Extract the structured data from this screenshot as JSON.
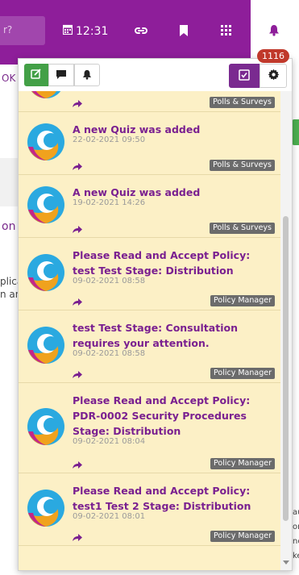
{
  "topbar": {
    "search_fragment": "r?",
    "time": "12:31",
    "background_color": "#8e1e9a"
  },
  "background_page": {
    "ok_label": "OK",
    "on_fragment": "on",
    "plica_fragment": "plica",
    "an_fragment": "n an",
    "right_fragments": [
      "au",
      "ori",
      "nov",
      "ke"
    ]
  },
  "toolbar": {
    "count": "1116",
    "icons": [
      "compose-icon",
      "comment-icon",
      "bell-icon",
      "checkbox-icon",
      "gear-icon"
    ]
  },
  "notifications": [
    {
      "title": "",
      "date": "",
      "tag": "Polls & Surveys"
    },
    {
      "title": "A new Quiz was added",
      "date": "22-02-2021 09:50",
      "tag": "Polls & Surveys"
    },
    {
      "title": "A new Quiz was added",
      "date": "19-02-2021 14:26",
      "tag": "Polls & Surveys"
    },
    {
      "title": "Please Read and Accept Policy: test Test Stage: Distribution",
      "date": "09-02-2021 08:58",
      "tag": "Policy Manager"
    },
    {
      "title": "test Test Stage: Consultation requires your attention.",
      "date": "09-02-2021 08:58",
      "tag": "Policy Manager"
    },
    {
      "title": "Please Read and Accept Policy: PDR-0002 Security Procedures Stage: Distribution",
      "date": "09-02-2021 08:04",
      "tag": "Policy Manager"
    },
    {
      "title": "Please Read and Accept Policy: test1 Test 2 Stage: Distribution",
      "date": "09-02-2021 08:01",
      "tag": "Policy Manager"
    }
  ],
  "colors": {
    "accent": "#8e1e9a",
    "item_bg": "#fcf0c6",
    "title": "#7a2090",
    "tag_bg": "#6b6b6b",
    "badge": "#c0392b",
    "green": "#43a047"
  }
}
